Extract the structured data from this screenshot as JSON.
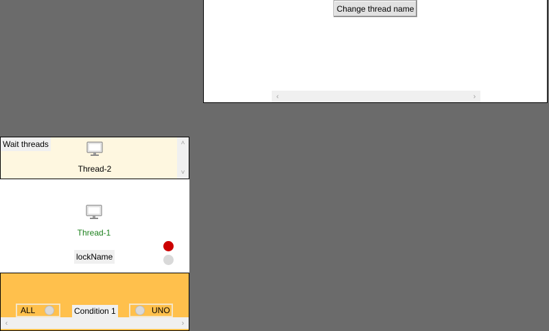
{
  "top_panel": {
    "change_thread_name_button": "Change thread name"
  },
  "wait_panel": {
    "label": "Wait threads",
    "thread_name": "Thread-2"
  },
  "lock_panel": {
    "thread_name": "Thread-1",
    "thread_name_color": "#1a7f1a",
    "lock_name": "lockName",
    "indicator_colors": [
      "#cc0000",
      "#d9d9d9"
    ]
  },
  "condition_panel": {
    "all_label": "ALL",
    "condition_label": "Condition 1",
    "uno_label": "UNO"
  },
  "icons": {
    "thread_icon": "monitor-icon",
    "scroll_left": "‹",
    "scroll_right": "›",
    "scroll_up": "˄",
    "scroll_down": "˅"
  }
}
